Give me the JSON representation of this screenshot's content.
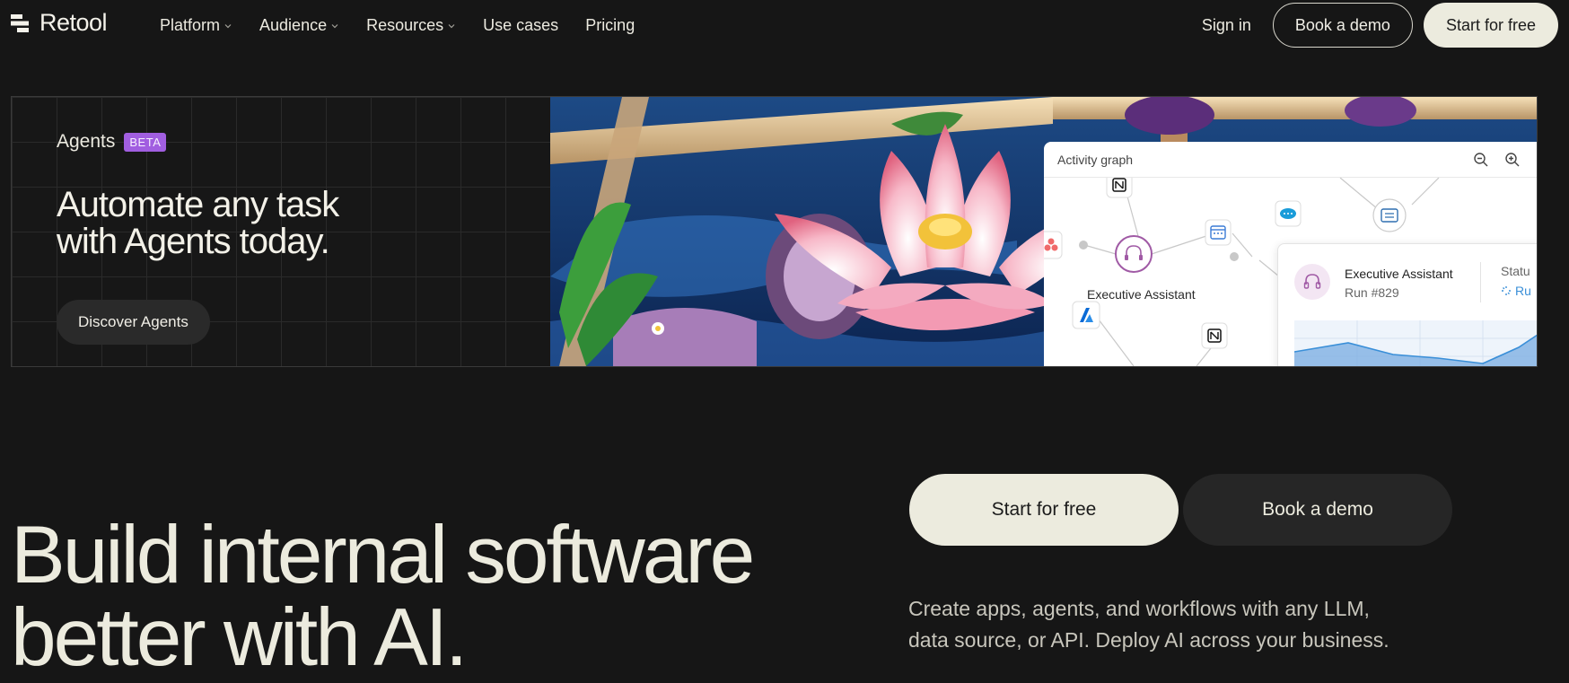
{
  "nav": {
    "logo_text": "Retool",
    "links": [
      {
        "label": "Platform",
        "has_dropdown": true
      },
      {
        "label": "Audience",
        "has_dropdown": true
      },
      {
        "label": "Resources",
        "has_dropdown": true
      },
      {
        "label": "Use cases",
        "has_dropdown": false
      },
      {
        "label": "Pricing",
        "has_dropdown": false
      }
    ],
    "sign_in": "Sign in",
    "book_demo": "Book a demo",
    "start_free": "Start for free"
  },
  "banner": {
    "label": "Agents",
    "badge": "BETA",
    "title": "Automate any task with Agents today.",
    "cta": "Discover Agents",
    "activity_card": {
      "title": "Activity graph",
      "node_label": "Executive Assistant"
    },
    "run_card": {
      "name": "Executive Assistant",
      "run_id": "Run #829",
      "status_label": "Statu",
      "status_value": "Ru"
    }
  },
  "hero": {
    "title": "Build internal software better with AI.",
    "primary_cta": "Start for free",
    "secondary_cta": "Book a demo",
    "description": "Create apps, agents, and workflows with any LLM, data source, or API. Deploy AI across your business."
  },
  "colors": {
    "background": "#161616",
    "text": "#ecebde",
    "button_light": "#ecebde",
    "button_dark": "#262626",
    "beta_badge": "#a15ee0"
  }
}
